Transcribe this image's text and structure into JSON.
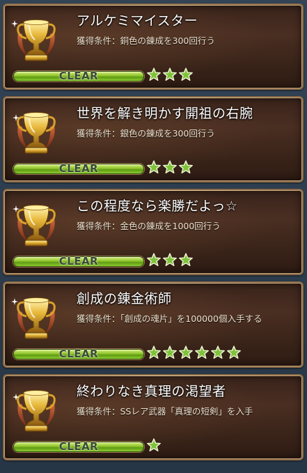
{
  "achievements": [
    {
      "title": "アルケミマイスター",
      "condition": "獲得条件：銅色の錬成を300回行う",
      "status": "CLEAR",
      "stars": 3
    },
    {
      "title": "世界を解き明かす開祖の右腕",
      "condition": "獲得条件：銀色の錬成を300回行う",
      "status": "CLEAR",
      "stars": 3
    },
    {
      "title": "この程度なら楽勝だよっ☆",
      "condition": "獲得条件：金色の錬成を1000回行う",
      "status": "CLEAR",
      "stars": 3
    },
    {
      "title": "創成の錬金術師",
      "condition": "獲得条件：「創成の魂片」を100000個入手する",
      "status": "CLEAR",
      "stars": 6
    },
    {
      "title": "終わりなき真理の渇望者",
      "condition": "獲得条件：SSレア武器「真理の短剣」を入手",
      "status": "CLEAR",
      "stars": 1
    }
  ],
  "icons": {
    "trophy": "gold-trophy-icon",
    "star": "green-star-icon"
  },
  "colors": {
    "card_border": "#8a6a48",
    "bar_green": "#8dc22c",
    "star_green": "#7fc23a"
  }
}
